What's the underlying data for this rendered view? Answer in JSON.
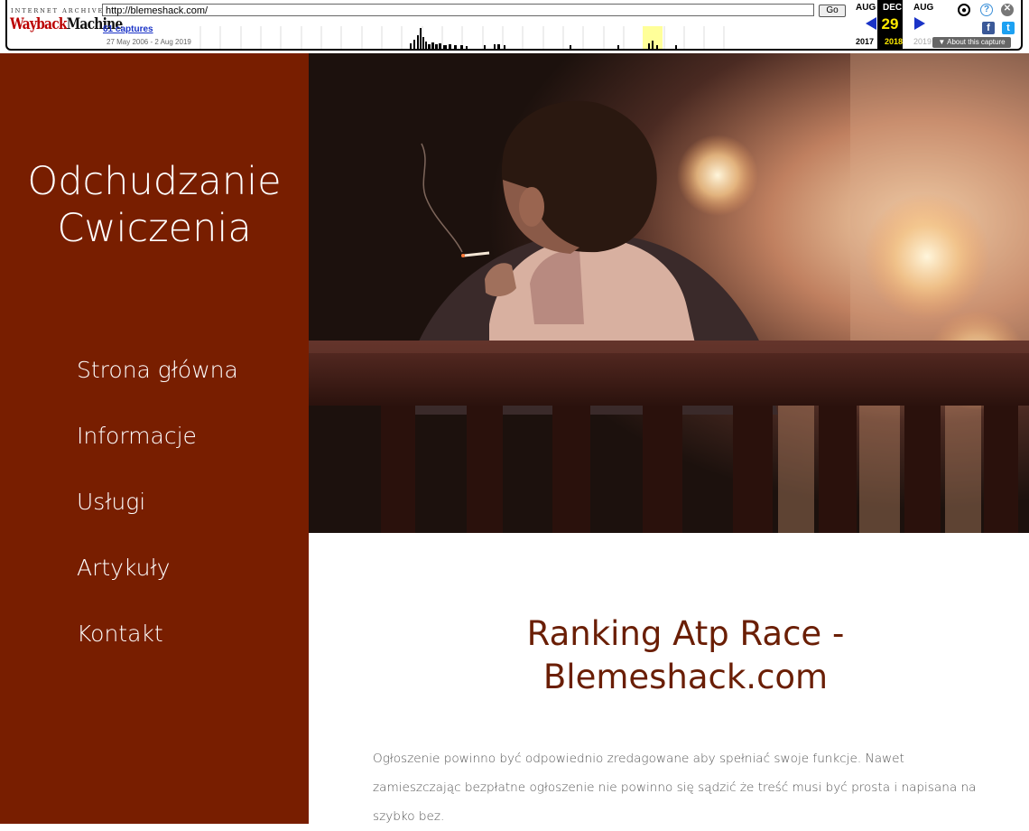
{
  "wayback": {
    "logo_top": "INTERNET ARCHIVE",
    "logo_wayback": "Wayback",
    "logo_machine": "Machine",
    "url": "http://blemeshack.com/",
    "go_label": "Go",
    "captures_link": "61 captures",
    "date_range": "27 May 2006 - 2 Aug 2019",
    "prev_month": "AUG",
    "current_month": "DEC",
    "next_month": "AUG",
    "current_day": "29",
    "prev_year": "2017",
    "current_year": "2018",
    "next_year": "2019",
    "about_label": "About this capture",
    "help_glyph": "?",
    "close_glyph": "✕",
    "facebook_glyph": "f",
    "twitter_glyph": "t",
    "colors": {
      "accent": "#1a33c7",
      "highlight": "#ffea00",
      "logo_red": "#b00000"
    }
  },
  "site": {
    "title_line1": "Odchudzanie",
    "title_line2": "Cwiczenia",
    "nav": [
      "Strona główna",
      "Informacje",
      "Usługi",
      "Artykuły",
      "Kontakt"
    ],
    "heading_line1": "Ranking Atp Race -",
    "heading_line2": "Blemeshack.com",
    "paragraph": "Ogłoszenie powinno być odpowiednio zredagowane aby spełniać swoje funkcje. Nawet zamieszczając bezpłatne ogłoszenie nie powinno się sądzić że treść musi być prosta i napisana na szybko bez.",
    "colors": {
      "sidebar": "#781e00",
      "heading": "#6a1e05"
    }
  }
}
